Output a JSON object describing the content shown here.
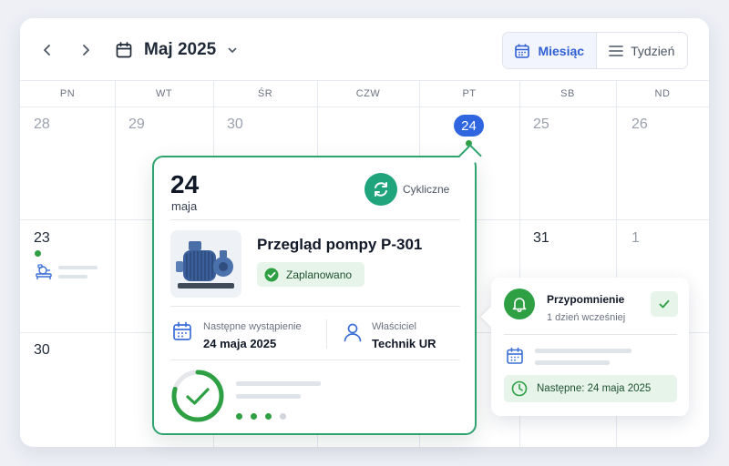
{
  "toolbar": {
    "prev_icon": "chevron-left-icon",
    "next_icon": "chevron-right-icon",
    "month_label": "Maj 2025",
    "calendar_icon": "calendar-icon",
    "dropdown_icon": "chevron-down-icon",
    "views": {
      "month": "Miesiąc",
      "week": "Tydzień"
    }
  },
  "weekdays": [
    "PN",
    "WT",
    "ŚR",
    "CZW",
    "PT",
    "SB",
    "ND"
  ],
  "days": {
    "row1": [
      "28",
      "29",
      "30",
      "24",
      "25",
      "26"
    ],
    "row2": [
      "23",
      "31",
      "1"
    ],
    "row3": [
      "30"
    ]
  },
  "popover": {
    "day": "24",
    "month": "maja",
    "recurring_label": "Cykliczne",
    "title": "Przegląd pompy P-301",
    "status": "Zaplanowano",
    "next_label": "Następne wystąpienie",
    "next_value": "24 maja 2025",
    "owner_label": "Właściciel",
    "owner_value": "Technik UR"
  },
  "reminder": {
    "title": "Przypomnienie",
    "subtitle": "1 dzień wcześniej",
    "next": "Następne: 24 maja 2025"
  },
  "colors": {
    "accent_blue": "#2f66e0",
    "accent_green": "#2ea043",
    "teal": "#1fa47c"
  }
}
